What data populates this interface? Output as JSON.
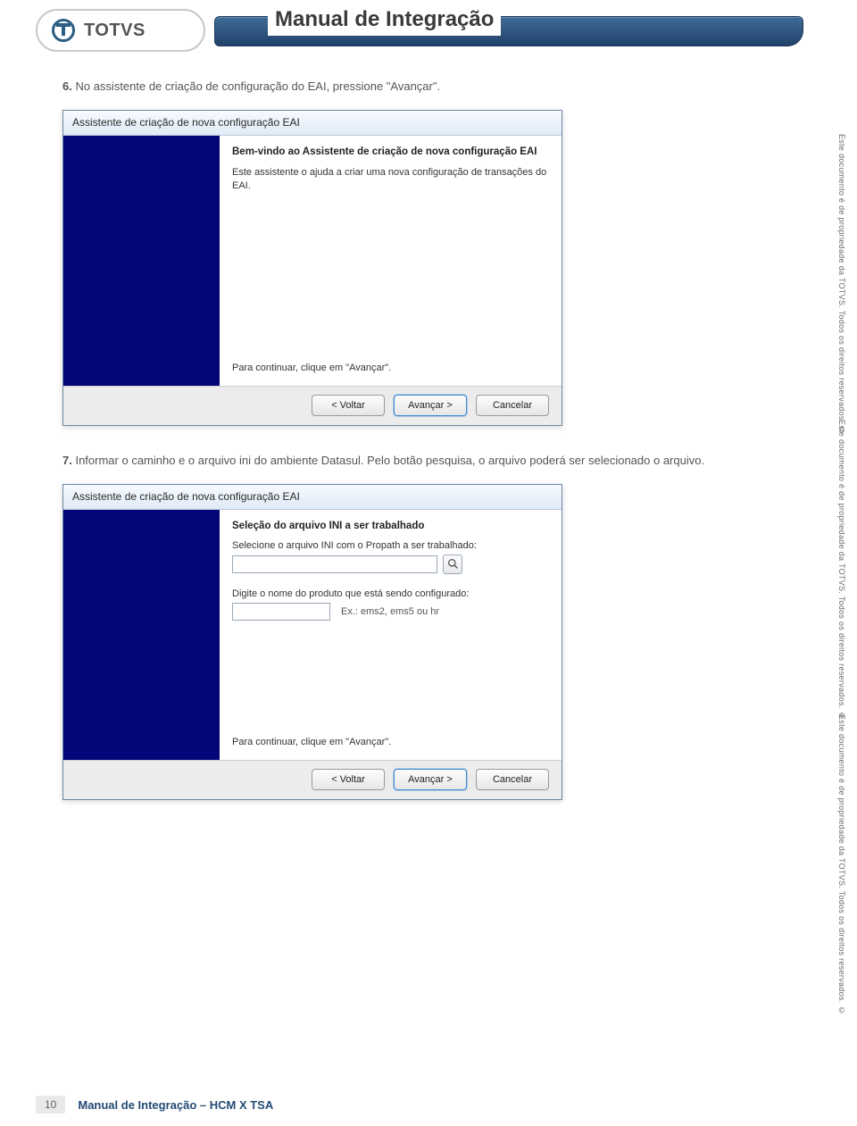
{
  "header": {
    "logo_text": "TOTVS",
    "doc_title": "Manual de Integração"
  },
  "side_notice": "Este documento é de propriedade da TOTVS. Todos os direitos reservados. ©",
  "steps": {
    "s6": {
      "num": "6.",
      "text": "No assistente de criação de configuração do EAI, pressione \"Avançar\"."
    },
    "s7": {
      "num": "7.",
      "text": "Informar o caminho e o arquivo ini do ambiente Datasul. Pelo botão pesquisa, o arquivo poderá ser selecionado o arquivo."
    }
  },
  "wizard": {
    "title": "Assistente de criação de nova configuração EAI",
    "welcome_heading": "Bem-vindo ao Assistente de criação de nova configuração EAI",
    "welcome_text": "Este assistente o ajuda a criar uma nova configuração de transações do EAI.",
    "continue_text": "Para continuar, clique em \"Avançar\".",
    "btn_back": "< Voltar",
    "btn_next": "Avançar >",
    "btn_cancel": "Cancelar"
  },
  "wizard2": {
    "heading": "Seleção do arquivo INI a ser trabalhado",
    "label_ini": "Selecione o arquivo INI com o Propath a ser trabalhado:",
    "ini_value": "",
    "search_icon": "search-icon",
    "label_prod": "Digite o nome do produto que está sendo configurado:",
    "prod_value": "",
    "prod_hint": "Ex.: ems2, ems5 ou hr"
  },
  "footer": {
    "page_number": "10",
    "title": "Manual de Integração – HCM X TSA"
  }
}
